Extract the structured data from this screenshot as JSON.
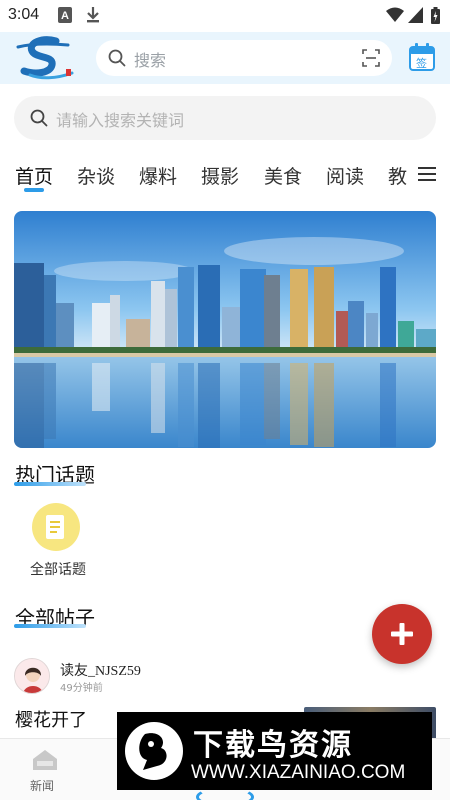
{
  "status_bar": {
    "time": "3:04",
    "icons": [
      "a-icon",
      "download-icon",
      "wifi-icon",
      "signal-icon",
      "battery-icon"
    ]
  },
  "header": {
    "logo": "s-logo",
    "search_placeholder": "搜索",
    "scan_icon": "scan-icon",
    "calendar_icon": "calendar-sign-icon",
    "calendar_label": "签"
  },
  "search2": {
    "placeholder": "请输入搜索关键词"
  },
  "tabs": {
    "items": [
      {
        "label": "首页",
        "active": true
      },
      {
        "label": "杂谈"
      },
      {
        "label": "爆料"
      },
      {
        "label": "摄影"
      },
      {
        "label": "美食"
      },
      {
        "label": "阅读"
      },
      {
        "label": "教"
      }
    ],
    "menu_icon": "hamburger-menu-icon"
  },
  "hot_topics": {
    "title": "热门话题",
    "items": [
      {
        "label": "全部话题",
        "icon": "document-icon"
      }
    ]
  },
  "all_posts": {
    "title": "全部帖子",
    "posts": [
      {
        "user": "读友_NJSZ59",
        "time": "49分钟前",
        "title": "樱花开了"
      }
    ]
  },
  "fab": {
    "icon": "plus-icon"
  },
  "bottom_nav": {
    "items": [
      {
        "label": "新闻",
        "icon": "home-icon"
      }
    ]
  },
  "watermark": {
    "line1": "下载鸟资源",
    "line2": "WWW.XIAZAINIAO.COM"
  },
  "colors": {
    "accent": "#2d9ce8",
    "header_bg": "#e9f5fd",
    "fab": "#c8332c",
    "topic_circle": "#f7e680"
  }
}
